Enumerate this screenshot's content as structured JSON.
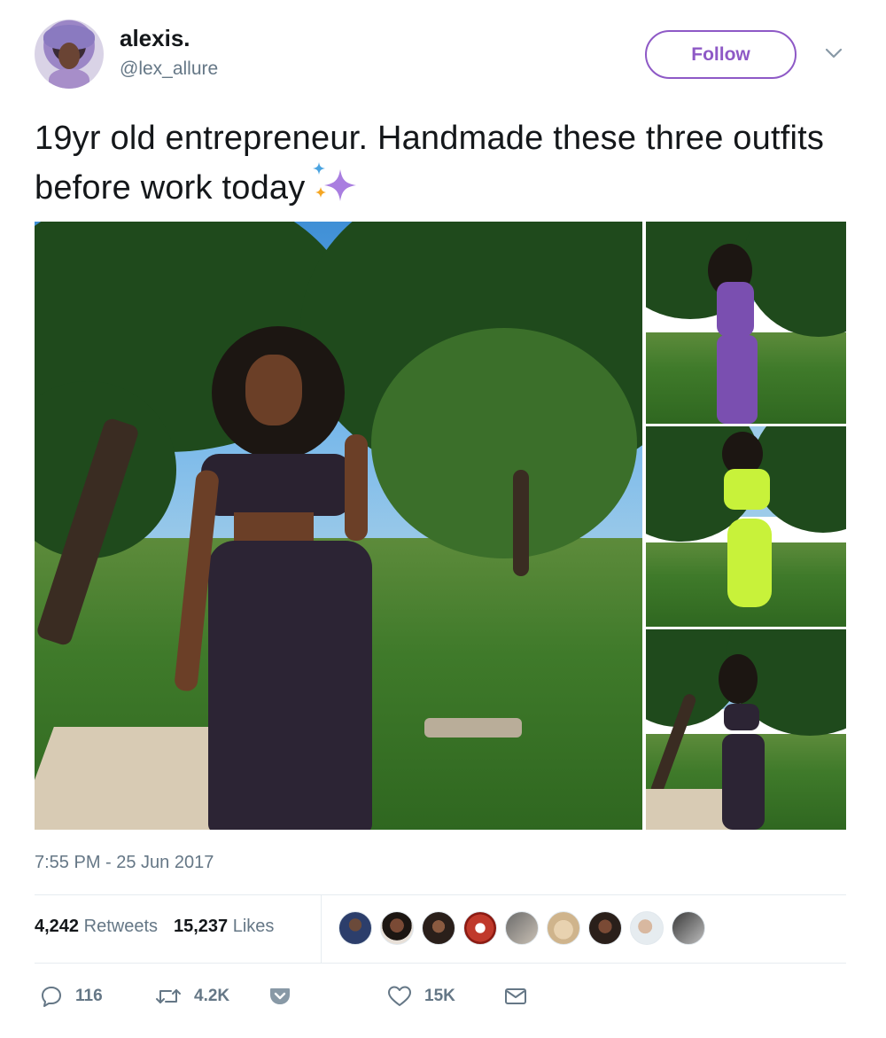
{
  "user": {
    "display_name": "alexis.",
    "handle": "@lex_allure"
  },
  "follow_label": "Follow",
  "tweet": {
    "text": "19yr old entrepreneur. Handmade these three outfits before work today",
    "emoji": "sparkles-icon"
  },
  "timestamp": "7:55 PM - 25 Jun 2017",
  "stats": {
    "retweets_count": "4,242",
    "retweets_label": "Retweets",
    "likes_count": "15,237",
    "likes_label": "Likes"
  },
  "actions": {
    "reply_count": "116",
    "retweet_count": "4.2K",
    "like_count": "15K"
  },
  "colors": {
    "accent": "#8e59c6",
    "secondary_text": "#657786"
  },
  "liker_avatars": 9
}
